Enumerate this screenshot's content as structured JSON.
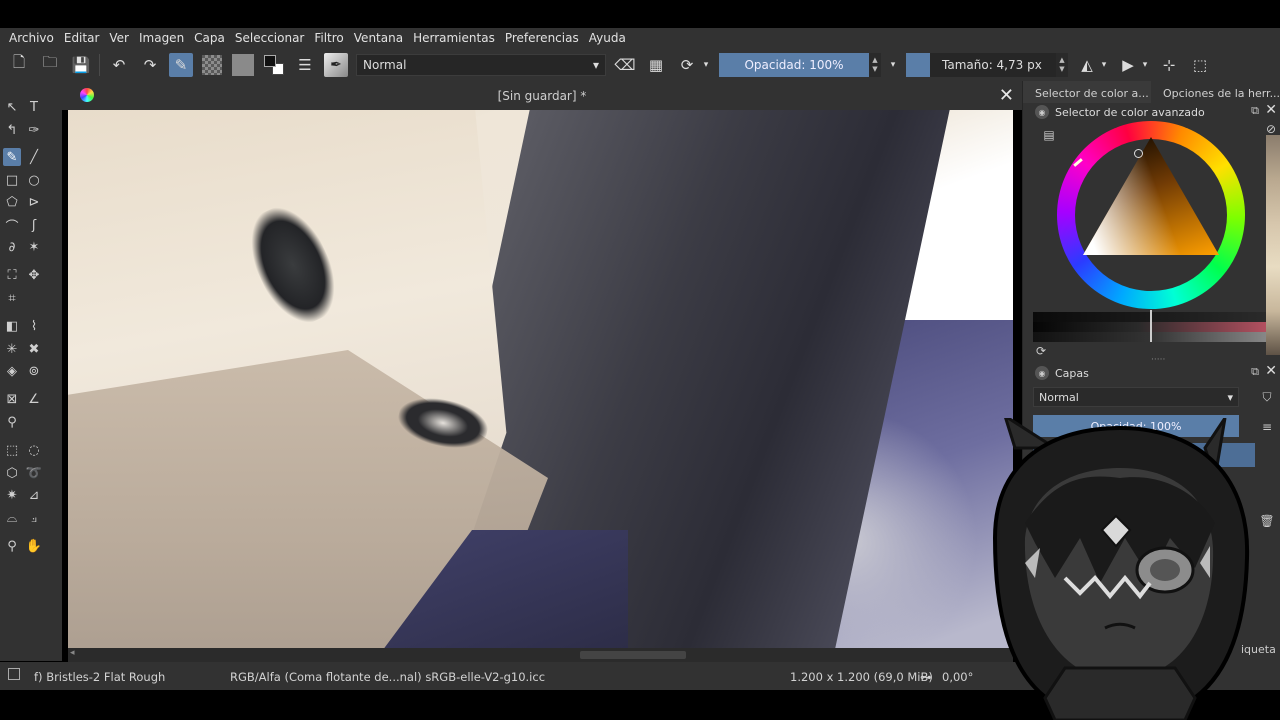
{
  "menu": {
    "items": [
      {
        "label": "Archivo"
      },
      {
        "label": "Editar"
      },
      {
        "label": "Ver"
      },
      {
        "label": "Imagen"
      },
      {
        "label": "Capa"
      },
      {
        "label": "Seleccionar"
      },
      {
        "label": "Filtro"
      },
      {
        "label": "Ventana"
      },
      {
        "label": "Herramientas"
      },
      {
        "label": "Preferencias"
      },
      {
        "label": "Ayuda"
      }
    ]
  },
  "toolbar": {
    "blend_mode": "Normal",
    "opacity_label": "Opacidad: 100%",
    "size_label": "Tamaño: 4,73 px",
    "accent_color": "#5a7ea8"
  },
  "document": {
    "title": "[Sin guardar]  *"
  },
  "dock": {
    "tabs": [
      "Selector de color a...",
      "Opciones de la herr..."
    ],
    "color_panel_title": "Selector de color avanzado",
    "layers_panel_title": "Capas",
    "layers_blend": "Normal",
    "layers_opacity": "Opacidad:  100%",
    "layers_bottom_label": "iqueta"
  },
  "status": {
    "brush": "f) Bristles-2 Flat Rough",
    "colorspace": "RGB/Alfa (Coma flotante de...nal)  sRGB-elle-V2-g10.icc",
    "dimensions": "1.200 x 1.200 (69,0 MiB)",
    "rotation": "0,00°"
  }
}
